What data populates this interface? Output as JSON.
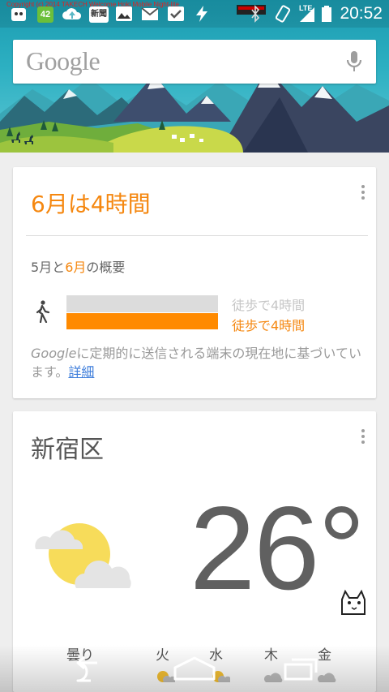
{
  "status_bar": {
    "copyright": "Copyright (c) 2014 TAKECH Welcome Hoki Mobile Night-lite",
    "badge_count": "42",
    "news_badge": "新聞",
    "network": "LTE",
    "time": "20:52"
  },
  "search": {
    "logo": "Google"
  },
  "activity_card": {
    "title": "6月は4時間",
    "overview_prefix": "5月と",
    "overview_highlight": "6月",
    "overview_suffix": "の概要",
    "prev_month_label": "徒歩で4時間",
    "cur_month_label": "徒歩で4時間",
    "prev_month_ratio": 1.0,
    "cur_month_ratio": 1.0,
    "note_brand": "Google",
    "note_text": "に定期的に送信される端末の現在地に基づいています。",
    "note_link": "詳細"
  },
  "weather_card": {
    "place": "新宿区",
    "temperature": "26°",
    "forecast": [
      {
        "label": "曇り"
      },
      {
        "label": "火"
      },
      {
        "label": "水"
      },
      {
        "label": "木"
      },
      {
        "label": "金"
      }
    ]
  },
  "colors": {
    "accent_orange": "#f5870f",
    "bar_gray": "#dcdcdc",
    "link_blue": "#3d7ddb"
  }
}
